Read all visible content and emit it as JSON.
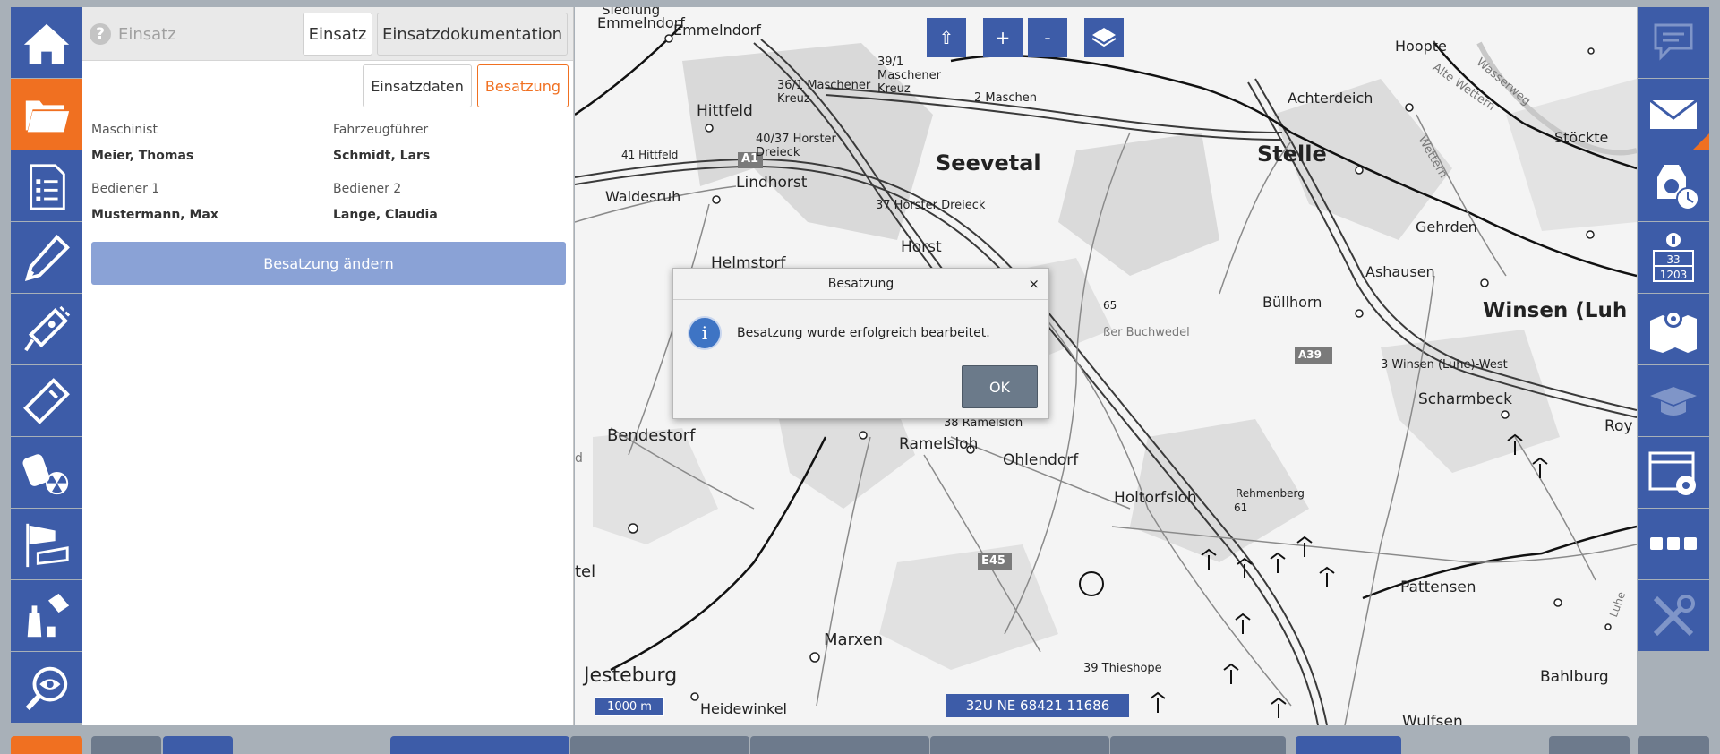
{
  "left_sidebar": {
    "items": [
      {
        "icon": "home-icon",
        "active": false
      },
      {
        "icon": "folder-icon",
        "active": true
      },
      {
        "icon": "checklist-icon",
        "active": false
      },
      {
        "icon": "pen-icon",
        "active": false
      },
      {
        "icon": "measuring-probe-icon",
        "active": false
      },
      {
        "icon": "handheld-device-icon",
        "active": false
      },
      {
        "icon": "dosimeter-radiation-icon",
        "active": false
      },
      {
        "icon": "windsock-icon",
        "active": false
      },
      {
        "icon": "bottles-icon",
        "active": false
      },
      {
        "icon": "eye-search-icon",
        "active": false
      }
    ]
  },
  "panel": {
    "help_label": "Einsatz",
    "tabs": [
      "Einsatz",
      "Einsatzdokumentation"
    ],
    "subtabs": [
      "Einsatzdaten",
      "Besatzung"
    ],
    "active_subtab": "Besatzung",
    "fields": {
      "maschinist_label": "Maschinist",
      "maschinist_value": "Meier, Thomas",
      "fahrzeugfuehrer_label": "Fahrzeugführer",
      "fahrzeugfuehrer_value": "Schmidt, Lars",
      "bediener1_label": "Bediener 1",
      "bediener1_value": "Mustermann, Max",
      "bediener2_label": "Bediener 2",
      "bediener2_value": "Lange, Claudia"
    },
    "change_button": "Besatzung ändern"
  },
  "map": {
    "controls": {
      "up": "⇧",
      "zoom_in": "+",
      "zoom_out": "-"
    },
    "scale": "1000 m",
    "coordinates": "32U NE 68421 11686",
    "labels": {
      "seevetal": "Seevetal",
      "stelle": "Stelle",
      "winsen": "Winsen (Luh",
      "emmelndorf": "Emmelndorf",
      "hittfeld": "Hittfeld",
      "lindhorst": "Lindhorst",
      "waldesruh": "Waldesruh",
      "helmstorf": "Helmstorf",
      "horst": "Horst",
      "maschen": "2 Maschen",
      "maschener_kreuz": "39/1 Maschener Kreuz",
      "maschener_kreuz2": "36/1 Maschener Kreuz",
      "horster_dreieck": "40/37 Horster Dreieck",
      "horster_dreieck2": "37 Horster Dreieck",
      "hittfeld_exit": "41 Hittfeld",
      "hoopte": "Hoopte",
      "achterdeich": "Achterdeich",
      "stoeckte": "Stöckte",
      "alte_wettern": "Alte Wettern",
      "wettern": "Wettern",
      "wasserweg": "Wasserweg",
      "gehrden": "Gehrden",
      "ashausen": "Ashausen",
      "buellhorn": "Büllhorn",
      "winsen_west": "3 Winsen (Luhe)-West",
      "scharmbeck": "Scharmbeck",
      "grosser_buchwedel": "ßer Buchwedel",
      "ramelsloh_exit": "38 Ramelsloh",
      "ramelsloh": "Ramelsloh",
      "ohlendorf": "Ohlendorf",
      "holtorfsloh": "Holtorfsloh",
      "rehmenberg": "Rehmenberg",
      "rehmenberg_alt": "61",
      "height65": "65",
      "bendestorf": "Bendestorf",
      "marxen": "Marxen",
      "jesteburg": "Jesteburg",
      "heidewinkel": "Heidewinkel",
      "thieshope": "39 Thieshope",
      "pattensen": "Pattensen",
      "bahlburg": "Bahlburg",
      "wulfsen": "Wulfsen",
      "roy": "Roy",
      "luhe": "Luhe",
      "tel": "tel",
      "d": "d",
      "a1": "A1",
      "a39": "A39",
      "e45": "E45",
      "siedlung": "Siedlung"
    }
  },
  "dialog": {
    "title": "Besatzung",
    "close": "×",
    "message": "Besatzung wurde erfolgreich bearbeitet.",
    "ok": "OK",
    "info_glyph": "i"
  },
  "right_sidebar": {
    "items": [
      {
        "icon": "chat-icon"
      },
      {
        "icon": "mail-icon"
      },
      {
        "icon": "breathing-apparatus-timer-icon"
      },
      {
        "icon": "info-code-icon",
        "text": "33\n1203"
      },
      {
        "icon": "map-pin-icon"
      },
      {
        "icon": "graduation-cap-icon"
      },
      {
        "icon": "window-settings-icon"
      },
      {
        "icon": "more-dots-icon"
      },
      {
        "icon": "tools-icon"
      }
    ],
    "code_line1": "33",
    "code_line2": "1203"
  },
  "colors": {
    "primary": "#3d5ca8",
    "accent": "#f07021",
    "disabled_button": "#8aa2d6"
  }
}
